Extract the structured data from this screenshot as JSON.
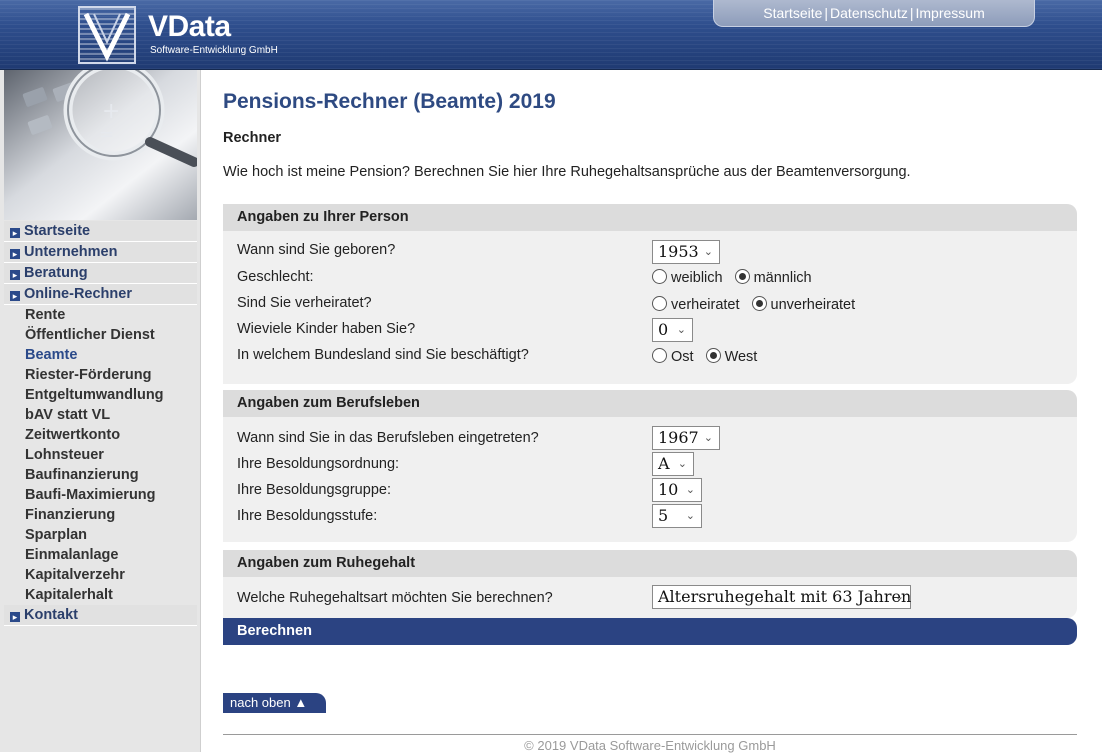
{
  "header": {
    "logo_name": "VData",
    "logo_sub": "Software-Entwicklung GmbH",
    "links": [
      "Startseite",
      "Datenschutz",
      "Impressum"
    ]
  },
  "sidebar": {
    "items": [
      {
        "label": "Startseite",
        "type": "main"
      },
      {
        "label": "Unternehmen",
        "type": "main"
      },
      {
        "label": "Beratung",
        "type": "main"
      },
      {
        "label": "Online-Rechner",
        "type": "main"
      },
      {
        "label": "Rente",
        "type": "sub"
      },
      {
        "label": "Öffentlicher Dienst",
        "type": "sub"
      },
      {
        "label": "Beamte",
        "type": "sub",
        "active": true
      },
      {
        "label": "Riester-Förderung",
        "type": "sub"
      },
      {
        "label": "Entgeltumwandlung",
        "type": "sub"
      },
      {
        "label": "bAV statt VL",
        "type": "sub"
      },
      {
        "label": "Zeitwertkonto",
        "type": "sub"
      },
      {
        "label": "Lohnsteuer",
        "type": "sub"
      },
      {
        "label": "Baufinanzierung",
        "type": "sub"
      },
      {
        "label": "Baufi-Maximierung",
        "type": "sub"
      },
      {
        "label": "Finanzierung",
        "type": "sub"
      },
      {
        "label": "Sparplan",
        "type": "sub"
      },
      {
        "label": "Einmalanlage",
        "type": "sub"
      },
      {
        "label": "Kapitalverzehr",
        "type": "sub"
      },
      {
        "label": "Kapitalerhalt",
        "type": "sub"
      },
      {
        "label": "Kontakt",
        "type": "main"
      }
    ]
  },
  "main": {
    "title": "Pensions-Rechner (Beamte) 2019",
    "subtitle": "Rechner",
    "intro": "Wie hoch ist meine Pension? Berechnen Sie hier Ihre Ruhegehaltsansprüche aus der Beamtenversorgung.",
    "person": {
      "heading": "Angaben zu Ihrer Person",
      "q_born": "Wann sind Sie geboren?",
      "born_value": "1953",
      "q_gender": "Geschlecht:",
      "gender_opts": [
        "weiblich",
        "männlich"
      ],
      "q_married": "Sind Sie verheiratet?",
      "married_opts": [
        "verheiratet",
        "unverheiratet"
      ],
      "q_kids": "Wieviele Kinder haben Sie?",
      "kids_value": "0",
      "q_state": "In welchem Bundesland sind Sie beschäftigt?",
      "state_opts": [
        "Ost",
        "West"
      ]
    },
    "career": {
      "heading": "Angaben zum Berufsleben",
      "q_start": "Wann sind Sie in das Berufsleben eingetreten?",
      "start_value": "1967",
      "q_order": "Ihre Besoldungsordnung:",
      "order_value": "A",
      "q_group": "Ihre Besoldungsgruppe:",
      "group_value": "10",
      "q_level": "Ihre Besoldungsstufe:",
      "level_value": "5"
    },
    "pension": {
      "heading": "Angaben zum Ruhegehalt",
      "q_type": "Welche Ruhegehaltsart möchten Sie berechnen?",
      "type_value": "Altersruhegehalt mit 63 Jahren"
    },
    "calc_label": "Berechnen",
    "top_label": "nach oben ▲",
    "footer": "© 2019 VData Software-Entwicklung GmbH"
  }
}
